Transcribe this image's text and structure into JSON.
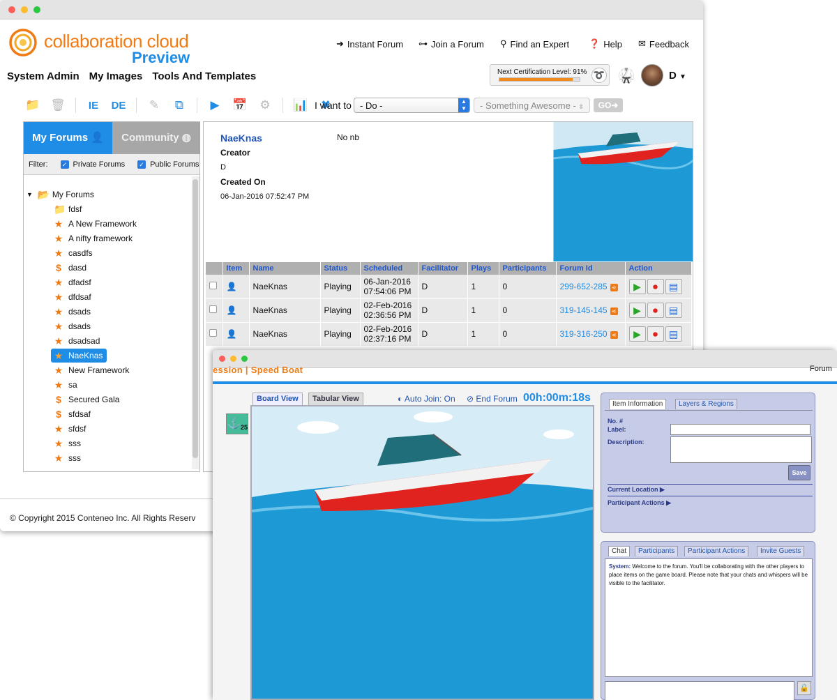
{
  "brand": {
    "name": "collaboration cloud",
    "edition": "Preview"
  },
  "top_nav": [
    {
      "icon": "arrow-circle-icon",
      "label": "Instant Forum"
    },
    {
      "icon": "link-icon",
      "label": "Join a Forum"
    },
    {
      "icon": "search-icon",
      "label": "Find an Expert"
    },
    {
      "icon": "help-icon",
      "label": "Help"
    },
    {
      "icon": "envelope-icon",
      "label": "Feedback"
    }
  ],
  "main_nav": [
    "System Admin",
    "My Images",
    "Tools And Templates"
  ],
  "certification": {
    "label": "Next Certification Level:",
    "percent_text": "91%",
    "progress": 0.91
  },
  "user": {
    "initial": "D"
  },
  "toolbar": {
    "i_want_label": "I want to",
    "do_select": "- Do -",
    "something_select": "- Something Awesome -",
    "go_label": "GO"
  },
  "left_panel": {
    "tab_my": "My Forums",
    "tab_community": "Community",
    "filter_label": "Filter:",
    "filter_private": "Private Forums",
    "filter_public": "Public Forums",
    "root": "My Forums",
    "items": [
      {
        "icon": "folder",
        "label": "fdsf"
      },
      {
        "icon": "star",
        "label": "A New Framework"
      },
      {
        "icon": "star",
        "label": "A nifty framework"
      },
      {
        "icon": "star",
        "label": "casdfs"
      },
      {
        "icon": "dollar",
        "label": "dasd"
      },
      {
        "icon": "star",
        "label": "dfadsf"
      },
      {
        "icon": "star",
        "label": "dfdsaf"
      },
      {
        "icon": "star",
        "label": "dsads"
      },
      {
        "icon": "star",
        "label": "dsads"
      },
      {
        "icon": "star",
        "label": "dsadsad"
      },
      {
        "icon": "star",
        "label": "NaeKnas",
        "selected": true
      },
      {
        "icon": "star",
        "label": "New Framework"
      },
      {
        "icon": "star",
        "label": "sa"
      },
      {
        "icon": "dollar",
        "label": "Secured Gala"
      },
      {
        "icon": "dollar",
        "label": "sfdsaf"
      },
      {
        "icon": "star",
        "label": "sfdsf"
      },
      {
        "icon": "star",
        "label": "sss"
      },
      {
        "icon": "star",
        "label": "sss"
      }
    ]
  },
  "detail": {
    "title": "NaeKnas",
    "no_nb": "No nb",
    "creator_label": "Creator",
    "creator_value": "D",
    "created_label": "Created On",
    "created_value": "06-Jan-2016 07:52:47 PM"
  },
  "forums_table": {
    "headers": [
      "",
      "Item",
      "Name",
      "Status",
      "Scheduled",
      "Facilitator",
      "Plays",
      "Participants",
      "Forum Id",
      "Action"
    ],
    "rows": [
      {
        "name": "NaeKnas",
        "status": "Playing",
        "date": "06-Jan-2016",
        "time": "07:54:06 PM",
        "facilitator": "D",
        "plays": "1",
        "participants": "0",
        "forum_id": "299-652-285"
      },
      {
        "name": "NaeKnas",
        "status": "Playing",
        "date": "02-Feb-2016",
        "time": "02:36:56 PM",
        "facilitator": "D",
        "plays": "1",
        "participants": "0",
        "forum_id": "319-145-145"
      },
      {
        "name": "NaeKnas",
        "status": "Playing",
        "date": "02-Feb-2016",
        "time": "02:37:16 PM",
        "facilitator": "D",
        "plays": "1",
        "participants": "0",
        "forum_id": "319-316-250"
      }
    ]
  },
  "footer": {
    "copyright": "© Copyright 2015 Conteneo Inc. All Rights Reserv"
  },
  "session": {
    "title": "ession | Speed Boat",
    "forum_label": "Forum",
    "tab_board": "Board View",
    "tab_tabular": "Tabular View",
    "auto_join": "Auto Join: On",
    "end_forum": "End Forum",
    "timer": "00h:00m:18s",
    "anchor_count": "25",
    "item_info": {
      "tab_info": "Item Information",
      "tab_layers": "Layers & Regions",
      "no_label": "No. #",
      "label_label": "Label:",
      "description_label": "Description:",
      "save": "Save",
      "current_location": "Current Location ▶",
      "participant_actions": "Participant Actions ▶"
    },
    "chat": {
      "tabs": [
        "Chat",
        "Participants",
        "Participant Actions",
        "Invite Guests"
      ],
      "system_label": "System:",
      "message": "Welcome to the forum. You'll be collaborating with the other players to place items on the game board. Please note that your chats and whispers will be visible to the facilitator."
    }
  },
  "colors": {
    "brand_orange": "#f07b14",
    "brand_blue": "#1f8ce6",
    "link_blue": "#2255bb"
  }
}
